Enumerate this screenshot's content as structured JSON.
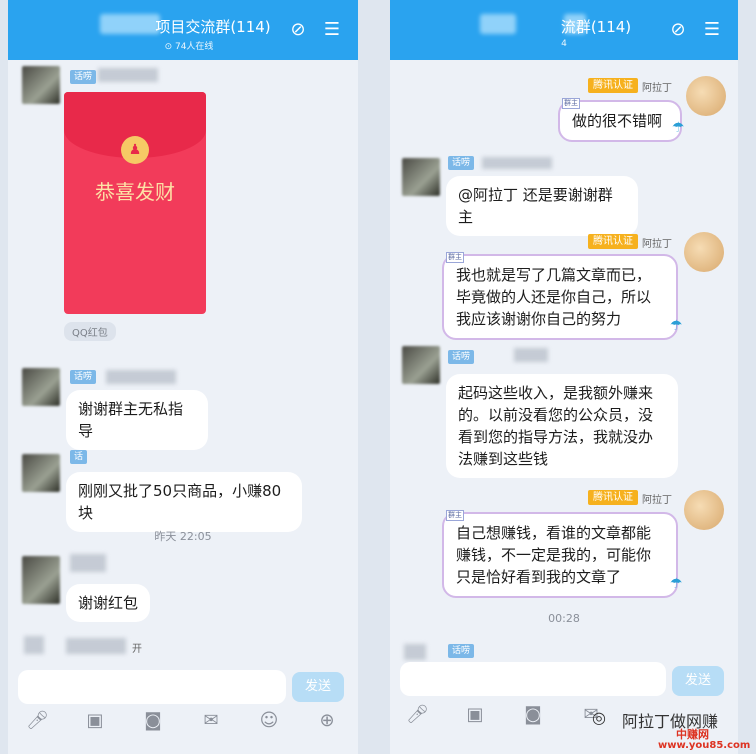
{
  "left": {
    "header": {
      "title": "项目交流群(114)",
      "subtitle": "74人在线"
    },
    "red_packet": {
      "text": "恭喜发财",
      "label": "QQ红包"
    },
    "messages": [
      {
        "tag": "话唠",
        "text": "谢谢群主无私指导"
      },
      {
        "tag": "话",
        "text": "刚刚又批了50只商品，小赚80块"
      },
      {
        "tag": "",
        "text": "谢谢红包"
      }
    ],
    "time": "昨天 22:05",
    "partial": "开",
    "send": "发送"
  },
  "right": {
    "header": {
      "title": "流群(114)",
      "subtitle": "4"
    },
    "badge": "腾讯认证",
    "owner": "阿拉丁",
    "qun": "群主",
    "messages": [
      {
        "text": "做的很不错啊"
      },
      {
        "tag": "话唠",
        "text": "@阿拉丁 还是要谢谢群主"
      },
      {
        "text": "我也就是写了几篇文章而已，毕竟做的人还是你自己，所以我应该谢谢你自己的努力"
      },
      {
        "tag": "话唠",
        "text": "起码这些收入，是我额外赚来的。以前没看您的公众员，没看到您的指导方法，我就没办法赚到这些钱"
      },
      {
        "text": "自己想赚钱，看谁的文章都能赚钱，不一定是我的，可能你只是恰好看到我的文章了"
      }
    ],
    "time": "00:28",
    "tag_bottom": "话唠",
    "send": "发送"
  },
  "watermark": {
    "text": "阿拉丁做网赚",
    "site": "中赚网",
    "url": "www.you85.com"
  },
  "colors": {
    "header": "#2aa3ef",
    "red_packet": "#f23b5a",
    "badge": "#f6b11e"
  },
  "icons": [
    "voice-icon",
    "image-icon",
    "camera-icon",
    "red-packet-icon",
    "emoji-icon",
    "plus-icon",
    "no-disturb-icon",
    "menu-icon"
  ]
}
